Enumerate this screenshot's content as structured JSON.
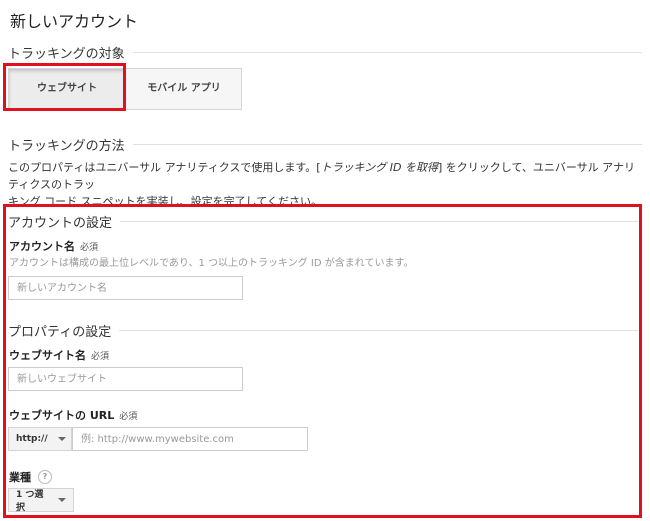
{
  "page": {
    "title": "新しいアカウント"
  },
  "tracking_target": {
    "heading": "トラッキングの対象",
    "tabs": [
      {
        "label": "ウェブサイト",
        "selected": true
      },
      {
        "label": "モバイル アプリ",
        "selected": false
      }
    ]
  },
  "tracking_method": {
    "heading": "トラッキングの方法",
    "desc_part1": "このプロパティはユニバーサル アナリティクスで使用します。[",
    "desc_em": "トラッキング ID を取得",
    "desc_part2": "] をクリックして、ユニバーサル アナリティクスのトラッ",
    "desc_line2": "キング コード スニペットを実装し、設定を完了してください。"
  },
  "account_settings": {
    "heading": "アカウントの設定",
    "account_name_label": "アカウント名",
    "required": "必須",
    "account_name_hint": "アカウントは構成の最上位レベルであり、1 つ以上のトラッキング ID が含まれています。",
    "account_name_placeholder": "新しいアカウント名"
  },
  "property_settings": {
    "heading": "プロパティの設定",
    "website_name_label": "ウェブサイト名",
    "website_name_placeholder": "新しいウェブサイト",
    "website_url_label": "ウェブサイトの URL",
    "protocol_value": "http://",
    "url_placeholder": "例: http://www.mywebsite.com",
    "industry_label": "業種",
    "industry_value": "1 つ選択",
    "help_glyph": "?"
  },
  "colors": {
    "highlight": "#e0101c"
  }
}
